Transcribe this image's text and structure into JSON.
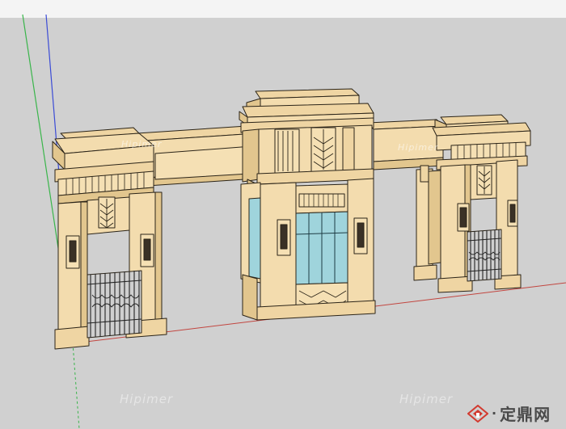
{
  "viewport": {
    "background_color": "#d0d0d0",
    "sky_color": "#f4f4f4",
    "axis_colors": {
      "green": "#39b54a",
      "blue": "#3b4bd6",
      "red": "#c2453f"
    }
  },
  "model": {
    "stone_color": "#f3dcae",
    "stone_shadow": "#e2c68e",
    "glass_color": "#9fd4dc",
    "iron_color": "#2a2a2a"
  },
  "watermarks": {
    "bottom_left": "Hipimer",
    "bottom_right": "Hipimer",
    "on_model_left": "Hipimer",
    "on_model_right": "Hipimer"
  },
  "brand": {
    "name": "定鼎网",
    "dot": "·",
    "logo_icon": "diamond-house-logo",
    "logo_color": "#d23a2f"
  }
}
